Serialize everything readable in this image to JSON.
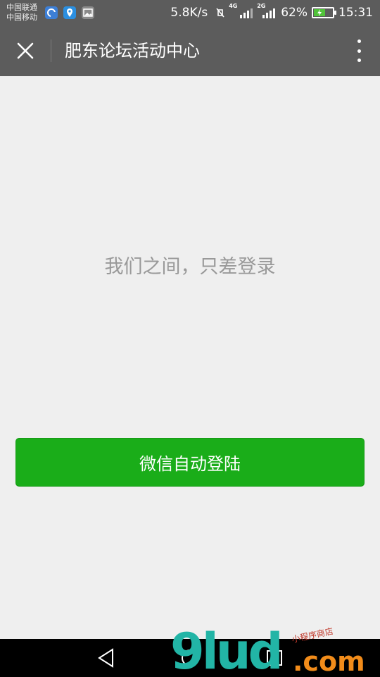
{
  "status_bar": {
    "carrier_1": "中国联通",
    "carrier_2": "中国移动",
    "net_speed": "5.8K/s",
    "network_1": "4G",
    "network_2": "2G",
    "battery_percent": "62%",
    "battery_level": 0.62,
    "time": "15:31",
    "notification_icons": [
      "browser-icon",
      "location-icon",
      "gallery-icon"
    ]
  },
  "nav": {
    "title": "肥东论坛活动中心",
    "close_icon": "close-icon",
    "more_icon": "more-vertical-icon"
  },
  "content": {
    "prompt": "我们之间，只差登录",
    "login_button": "微信自动登陆"
  },
  "system_nav": {
    "buttons": [
      "back-icon",
      "home-icon",
      "recent-apps-icon"
    ]
  },
  "watermark": {
    "logo": "9lud",
    "suffix": ".com",
    "caption": "小程序商店"
  },
  "colors": {
    "header_bg": "#5c5c5c",
    "page_bg": "#efefef",
    "accent_green": "#1aad19",
    "prompt_text": "#999999"
  }
}
